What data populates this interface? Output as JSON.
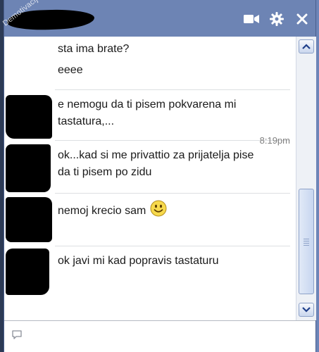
{
  "watermark": "Demotivacija.rs",
  "header": {
    "icons": [
      "video-call-icon",
      "gear-icon",
      "close-icon"
    ]
  },
  "messages": [
    {
      "lines": [
        "sta ima brate?",
        "eeee"
      ]
    },
    {
      "lines": [
        "e nemogu da ti  pisem pokvarena mi",
        "tastatura,..."
      ]
    },
    {
      "timestamp": "8:19pm",
      "lines": [
        "ok...kad si me privattio za prijatelja pise",
        "da ti pisem po zidu"
      ]
    },
    {
      "lines": [
        "nemoj krecio sam"
      ],
      "emoticon": "smiley-icon"
    },
    {
      "lines": [
        "ok javi mi kad popravis tastaturu"
      ]
    }
  ],
  "composer": {
    "value": "",
    "icon": "speech-bubble-icon"
  },
  "colors": {
    "titlebar": "#6d84b4",
    "scroll_accent": "#8ea2c8"
  }
}
